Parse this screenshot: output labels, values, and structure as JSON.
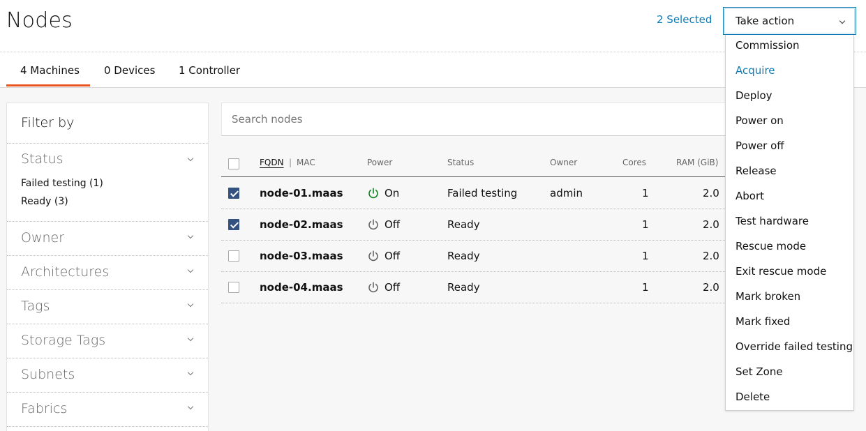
{
  "header": {
    "title": "Nodes",
    "selected_count": "2 Selected",
    "take_action_label": "Take action"
  },
  "tabs": [
    {
      "label": "4 Machines",
      "active": true
    },
    {
      "label": "0 Devices",
      "active": false
    },
    {
      "label": "1 Controller",
      "active": false
    }
  ],
  "sidebar": {
    "title": "Filter by",
    "groups": [
      {
        "label": "Status",
        "options": [
          "Failed testing (1)",
          "Ready (3)"
        ]
      },
      {
        "label": "Owner"
      },
      {
        "label": "Architectures"
      },
      {
        "label": "Tags"
      },
      {
        "label": "Storage Tags"
      },
      {
        "label": "Subnets"
      },
      {
        "label": "Fabrics"
      }
    ]
  },
  "search": {
    "placeholder": "Search nodes"
  },
  "table": {
    "columns": {
      "fqdn": "FQDN",
      "mac": "MAC",
      "power": "Power",
      "status": "Status",
      "owner": "Owner",
      "cores": "Cores",
      "ram": "RAM (GiB)"
    },
    "rows": [
      {
        "selected": true,
        "fqdn": "node-01.maas",
        "power": "On",
        "status": "Failed testing",
        "owner": "admin",
        "cores": "1",
        "ram": "2.0"
      },
      {
        "selected": true,
        "fqdn": "node-02.maas",
        "power": "Off",
        "status": "Ready",
        "owner": "",
        "cores": "1",
        "ram": "2.0"
      },
      {
        "selected": false,
        "fqdn": "node-03.maas",
        "power": "Off",
        "status": "Ready",
        "owner": "",
        "cores": "1",
        "ram": "2.0"
      },
      {
        "selected": false,
        "fqdn": "node-04.maas",
        "power": "Off",
        "status": "Ready",
        "owner": "",
        "cores": "1",
        "ram": "2.0"
      }
    ]
  },
  "take_action_menu": [
    "Commission",
    "Acquire",
    "Deploy",
    "Power on",
    "Power off",
    "Release",
    "Abort",
    "Test hardware",
    "Rescue mode",
    "Exit rescue mode",
    "Mark broken",
    "Mark fixed",
    "Override failed testing",
    "Set Zone",
    "Delete"
  ],
  "colors": {
    "accent": "#0e7bb4",
    "tab_active": "#e95420",
    "checkbox_checked": "#335280",
    "power_on": "#0e8420",
    "power_off": "#666666"
  },
  "icons": {
    "power": "power-icon",
    "chevron": "chevron-down-icon"
  }
}
